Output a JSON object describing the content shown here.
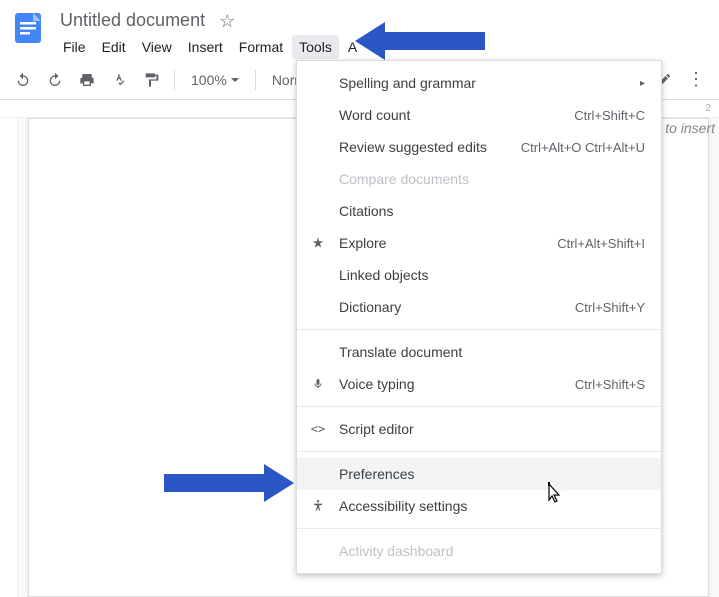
{
  "header": {
    "title": "Untitled document"
  },
  "menubar": {
    "file": "File",
    "edit": "Edit",
    "view": "View",
    "insert": "Insert",
    "format": "Format",
    "tools": "Tools",
    "addons": "A"
  },
  "toolbar": {
    "zoom": "100%",
    "style": "Normal"
  },
  "hint": "to insert",
  "ruler": {
    "t2": "2"
  },
  "dropdown": {
    "spelling": "Spelling and grammar",
    "wordcount": {
      "label": "Word count",
      "shortcut": "Ctrl+Shift+C"
    },
    "review": {
      "label": "Review suggested edits",
      "shortcut": "Ctrl+Alt+O Ctrl+Alt+U"
    },
    "compare": "Compare documents",
    "citations": "Citations",
    "explore": {
      "label": "Explore",
      "shortcut": "Ctrl+Alt+Shift+I"
    },
    "linked": "Linked objects",
    "dictionary": {
      "label": "Dictionary",
      "shortcut": "Ctrl+Shift+Y"
    },
    "translate": "Translate document",
    "voice": {
      "label": "Voice typing",
      "shortcut": "Ctrl+Shift+S"
    },
    "script": "Script editor",
    "preferences": "Preferences",
    "accessibility": "Accessibility settings",
    "activity": "Activity dashboard"
  }
}
